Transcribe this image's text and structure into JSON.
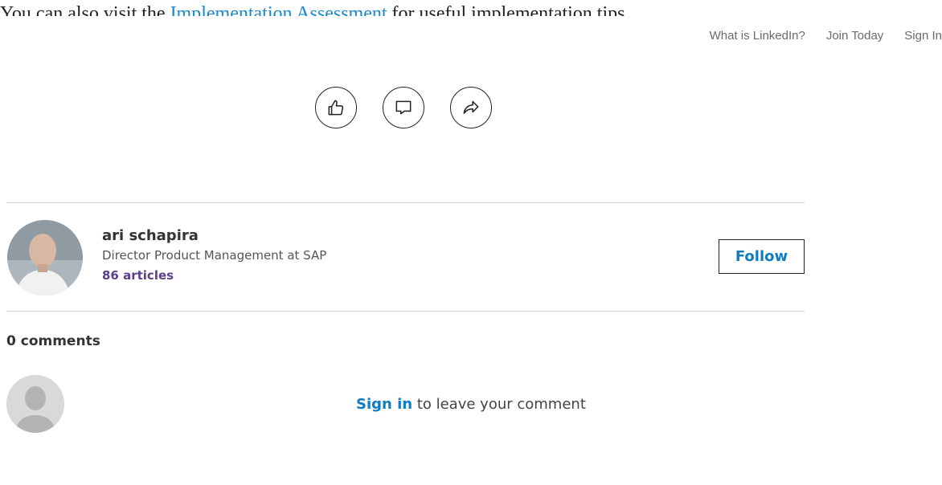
{
  "clipped_banner": {
    "lead": "You can also visit the ",
    "link": "Implementation Assessment",
    "tail": " for useful implementation tips."
  },
  "topnav": {
    "what_is": "What is LinkedIn?",
    "join": "Join Today",
    "sign_in": "Sign In"
  },
  "actions": {
    "like_icon": "thumbs-up-icon",
    "comment_icon": "comment-bubble-icon",
    "share_icon": "share-arrow-icon"
  },
  "author": {
    "name": "ari schapira",
    "headline": "Director Product Management at SAP",
    "articles": "86 articles",
    "follow_label": "Follow"
  },
  "comments": {
    "count_label": "0 comments",
    "signin_link": "Sign in",
    "prompt_tail": " to leave your comment"
  },
  "colors": {
    "link_blue": "#0e7cc2",
    "articles_purple": "#5a3f8a",
    "divider": "#d8d8d8"
  }
}
